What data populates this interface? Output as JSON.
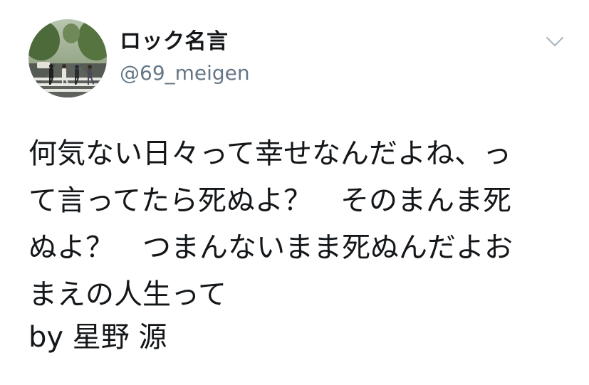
{
  "account": {
    "display_name": "ロック名言",
    "handle": "@69_meigen",
    "avatar_icon": "abbey-road-crossing-photo"
  },
  "tweet": {
    "lines": [
      "何気ない日々って幸せなんだよね、っ",
      "て言ってたら死ぬよ？　そのまんま死",
      "ぬよ？　つまんないまま死ぬんだよお",
      "まえの人生って"
    ],
    "attribution": "by 星野 源"
  },
  "menu": {
    "caret_icon": "chevron-down-icon"
  },
  "colors": {
    "text": "#14171a",
    "secondary": "#657786",
    "caret": "#aab8c2"
  }
}
